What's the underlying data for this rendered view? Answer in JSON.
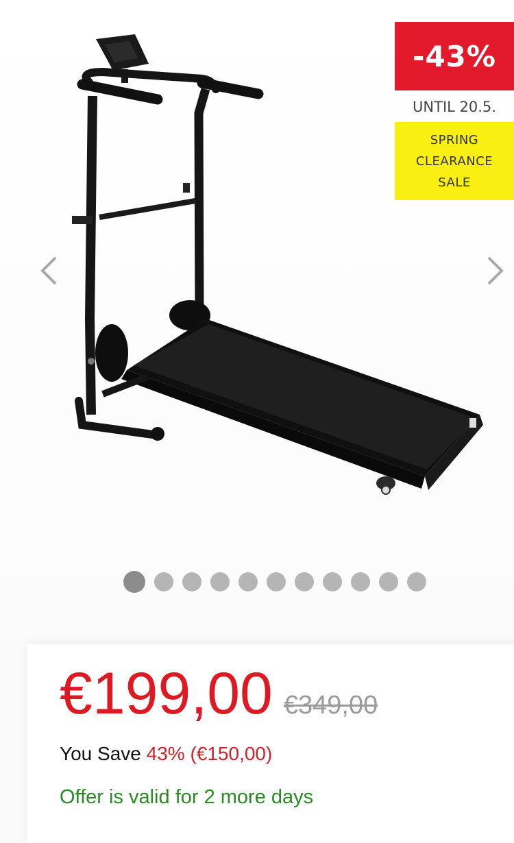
{
  "product": {
    "image_alt": "Manual folding treadmill, black"
  },
  "badges": {
    "discount": "-43%",
    "until": "UNTIL 20.5.",
    "sale_lines": [
      "SPRING",
      "CLEARANCE",
      "SALE"
    ]
  },
  "gallery": {
    "slide_count": 11,
    "active_index": 0
  },
  "pricing": {
    "current_price": "€199,00",
    "old_price": "€349,00",
    "save_label": "You Save ",
    "save_amount": "43% (€150,00)",
    "offer_text": "Offer is valid for 2 more days"
  },
  "icons": {
    "prev": "chevron-left-icon",
    "next": "chevron-right-icon"
  },
  "colors": {
    "discount_red": "#e1192a",
    "sale_yellow": "#f9ef12",
    "price_red": "#dd1a23",
    "offer_green": "#2a8a24"
  }
}
